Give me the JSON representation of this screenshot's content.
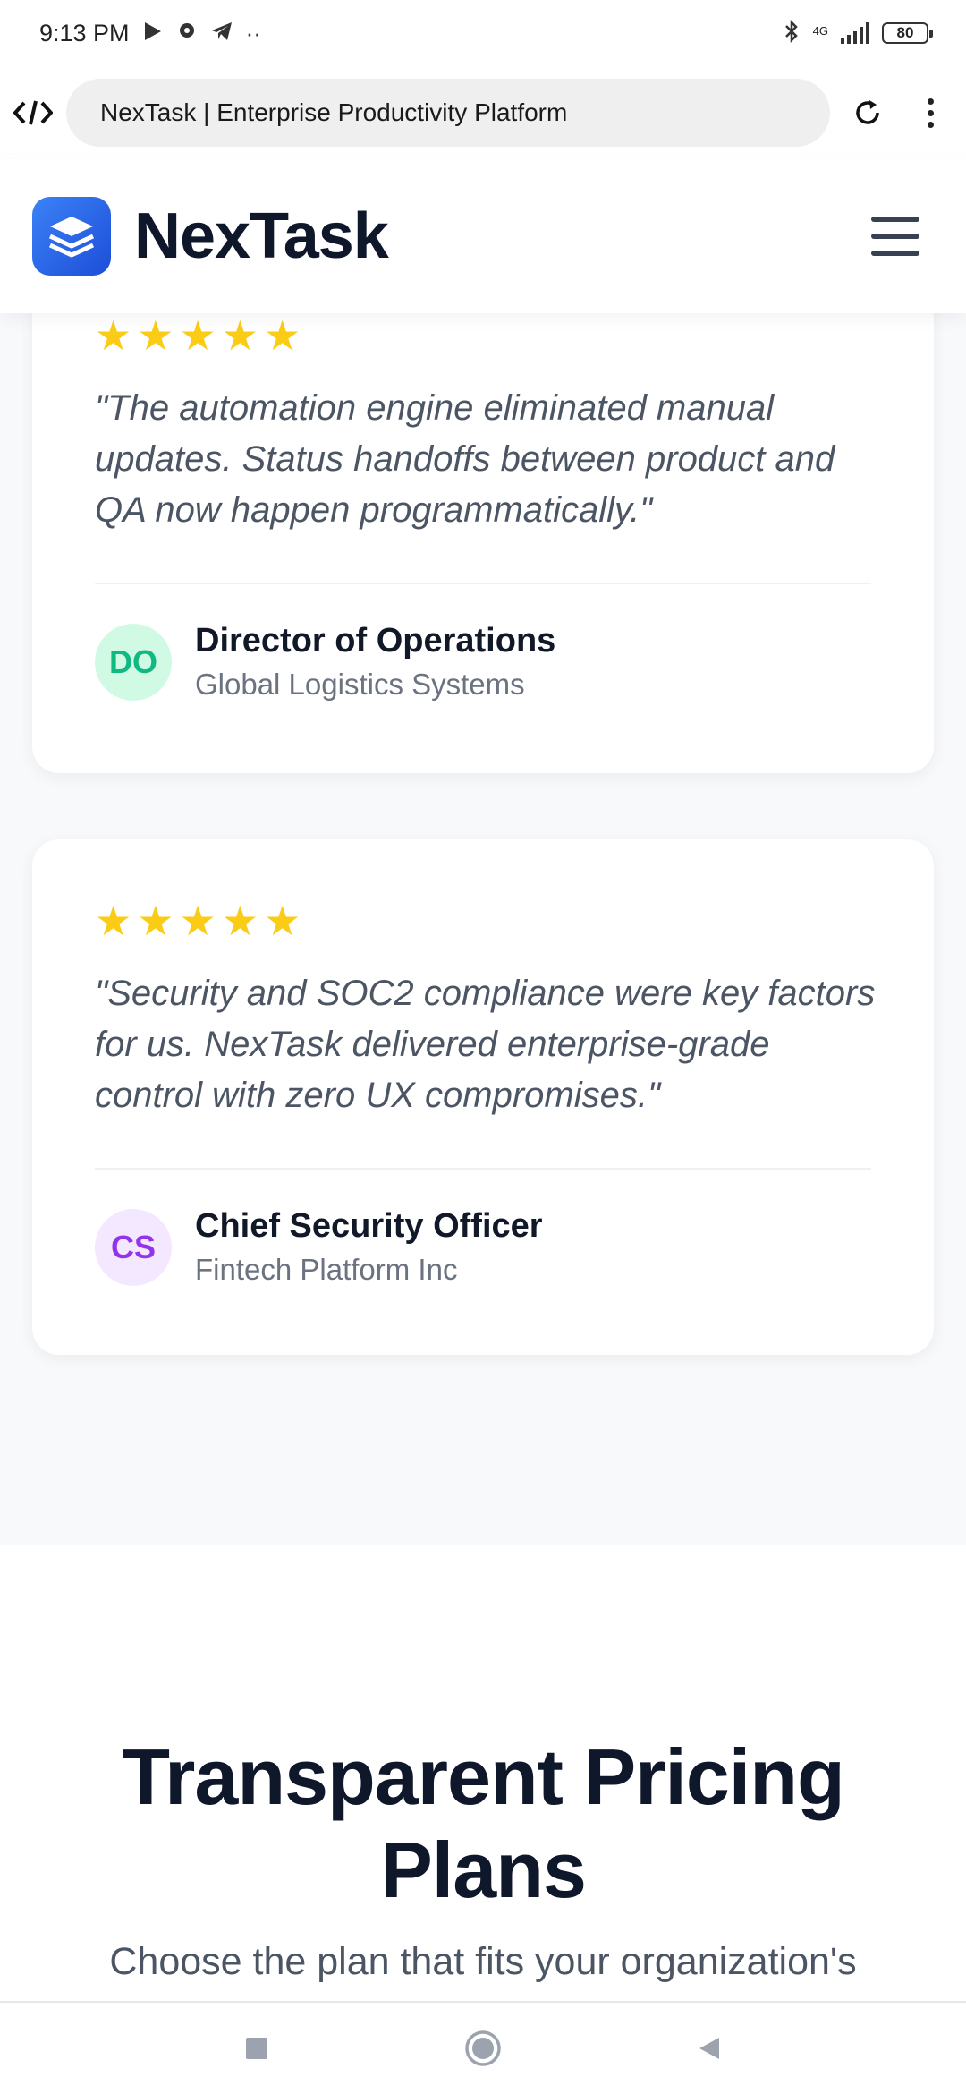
{
  "status_bar": {
    "time": "9:13 PM",
    "network": "4G",
    "battery": "80"
  },
  "browser": {
    "url_title": "NexTask | Enterprise Productivity Platform"
  },
  "header": {
    "brand_name": "NexTask"
  },
  "testimonials": [
    {
      "rating": 5,
      "quote": "\"The automation engine eliminated manual updates. Status handoffs between product and QA now happen programmatically.\"",
      "initials": "DO",
      "name": "Director of Operations",
      "company": "Global Logistics Systems"
    },
    {
      "rating": 5,
      "quote": "\"Security and SOC2 compliance were key factors for us. NexTask delivered enterprise-grade control with zero UX compromises.\"",
      "initials": "CS",
      "name": "Chief Security Officer",
      "company": "Fintech Platform Inc"
    }
  ],
  "pricing": {
    "title": "Transparent Pricing Plans",
    "subtitle": "Choose the plan that fits your organization's"
  },
  "colors": {
    "accent": "#2563eb",
    "star": "#facc15",
    "avatar_do": "#10b981",
    "avatar_cs": "#9333ea"
  }
}
